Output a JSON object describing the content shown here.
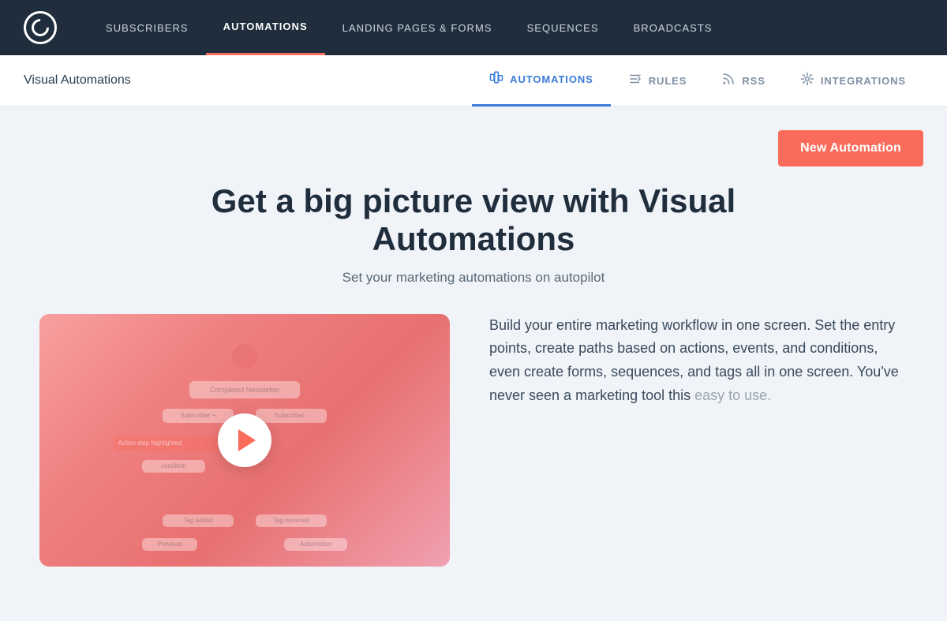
{
  "brand": {
    "logo_label": "ConvertKit"
  },
  "top_nav": {
    "links": [
      {
        "label": "SUBSCRIBERS",
        "active": false
      },
      {
        "label": "AUTOMATIONS",
        "active": true
      },
      {
        "label": "LANDING PAGES & FORMS",
        "active": false
      },
      {
        "label": "SEQUENCES",
        "active": false
      },
      {
        "label": "BROADCASTS",
        "active": false
      }
    ]
  },
  "sub_nav": {
    "title": "Visual Automations",
    "links": [
      {
        "label": "AUTOMATIONS",
        "icon": "⇄",
        "active": true
      },
      {
        "label": "RULES",
        "icon": "✂",
        "active": false
      },
      {
        "label": "RSS",
        "icon": "▣",
        "active": false
      },
      {
        "label": "INTEGRATIONS",
        "icon": "⬡",
        "active": false
      }
    ]
  },
  "action_button": {
    "label": "New Automation"
  },
  "hero": {
    "title": "Get a big picture view with Visual Automations",
    "subtitle": "Set your marketing automations on autopilot"
  },
  "video": {
    "aria_label": "Visual Automations Demo Video",
    "play_label": "Play"
  },
  "description": {
    "text_main": "Build your entire marketing workflow in one screen. Set the entry points, create paths based on actions, events, and conditions, even create forms, sequences, and tags all in one screen. You've never seen a marketing tool this ",
    "text_muted": "easy to use."
  }
}
